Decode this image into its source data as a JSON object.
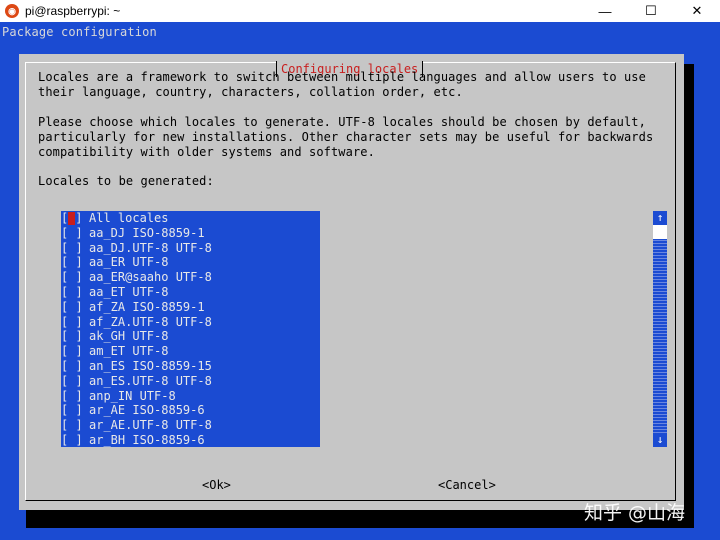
{
  "window": {
    "title": "pi@raspberrypi: ~",
    "minimize": "—",
    "maximize": "☐",
    "close": "✕"
  },
  "terminal": {
    "header": "Package configuration"
  },
  "dialog": {
    "title": "Configuring locales",
    "para1": "Locales are a framework to switch between multiple languages and allow users to use\ntheir language, country, characters, collation order, etc.",
    "para2": "Please choose which locales to generate. UTF-8 locales should be chosen by default,\nparticularly for new installations. Other character sets may be useful for backwards\ncompatibility with older systems and software.",
    "list_label": "Locales to be generated:",
    "items": [
      {
        "checked": false,
        "label": "All locales"
      },
      {
        "checked": false,
        "label": "aa_DJ ISO-8859-1"
      },
      {
        "checked": false,
        "label": "aa_DJ.UTF-8 UTF-8"
      },
      {
        "checked": false,
        "label": "aa_ER UTF-8"
      },
      {
        "checked": false,
        "label": "aa_ER@saaho UTF-8"
      },
      {
        "checked": false,
        "label": "aa_ET UTF-8"
      },
      {
        "checked": false,
        "label": "af_ZA ISO-8859-1"
      },
      {
        "checked": false,
        "label": "af_ZA.UTF-8 UTF-8"
      },
      {
        "checked": false,
        "label": "ak_GH UTF-8"
      },
      {
        "checked": false,
        "label": "am_ET UTF-8"
      },
      {
        "checked": false,
        "label": "an_ES ISO-8859-15"
      },
      {
        "checked": false,
        "label": "an_ES.UTF-8 UTF-8"
      },
      {
        "checked": false,
        "label": "anp_IN UTF-8"
      },
      {
        "checked": false,
        "label": "ar_AE ISO-8859-6"
      },
      {
        "checked": false,
        "label": "ar_AE.UTF-8 UTF-8"
      },
      {
        "checked": false,
        "label": "ar_BH ISO-8859-6"
      }
    ],
    "checkbox_open": "[",
    "checkbox_close": "]",
    "ok_label": "<Ok>",
    "cancel_label": "<Cancel>",
    "scroll_up": "↑",
    "scroll_down": "↓"
  },
  "watermark": "知乎 @山海",
  "colors": {
    "terminal_blue": "#1b4bd2",
    "dialog_gray": "#c6c6c6",
    "title_red": "#c81e1e"
  }
}
